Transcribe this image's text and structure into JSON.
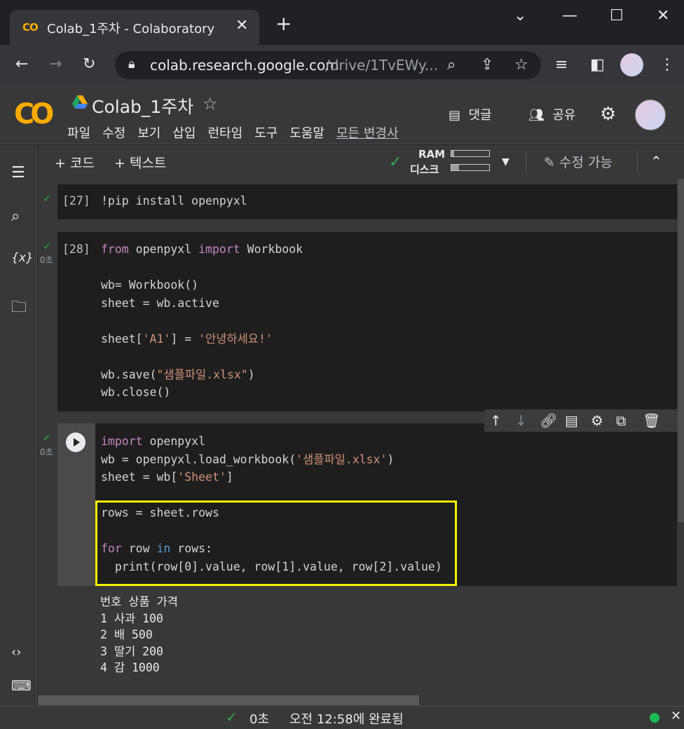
{
  "browser": {
    "tab_logo": "CO",
    "tab_title": "Colab_1주차 - Colaboratory",
    "url_host": "colab.research.google.com",
    "url_path": "/drive/1TvEWy..."
  },
  "colab": {
    "logo": "CO",
    "notebook_title": "Colab_1주차",
    "menu": [
      "파일",
      "수정",
      "보기",
      "삽입",
      "런타임",
      "도구",
      "도움말"
    ],
    "menu_last": "모든 변경사",
    "comment_label": "댓글",
    "share_label": "공유"
  },
  "toolbar": {
    "add_code": "+ 코드",
    "add_text": "+ 텍스트",
    "ram_label": "RAM",
    "disk_label": "디스크",
    "ram_usage": 0.08,
    "disk_usage": 0.2,
    "edit_label": "수정 가능"
  },
  "cells": {
    "c1": {
      "exec": "[27]",
      "code": "!pip install openpyxl"
    },
    "c2": {
      "exec": "[28]",
      "duration": "0초"
    },
    "c3": {
      "duration": "0초"
    }
  },
  "output_lines": [
    "번호 상품 가격",
    "1 사과 100",
    "2 배 500",
    "3 딸기 200",
    "4 감 1000"
  ],
  "status": {
    "time": "0초",
    "message": "오전 12:58에 완료됨"
  },
  "colors": {
    "accent": "#f9ab00",
    "success": "#34a853",
    "highlight": "#f5f000"
  }
}
